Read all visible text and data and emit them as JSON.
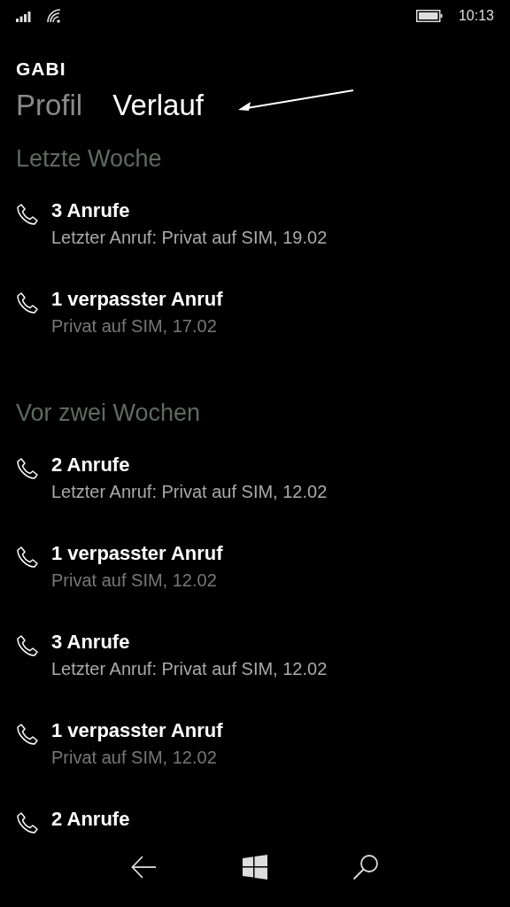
{
  "status_bar": {
    "time": "10:13"
  },
  "contact": {
    "name": "GABI"
  },
  "tabs": [
    {
      "label": "Profil",
      "selected": false
    },
    {
      "label": "Verlauf",
      "selected": true
    }
  ],
  "sections": [
    {
      "title": "Letzte Woche",
      "items": [
        {
          "kind": "calls",
          "title": "3 Anrufe",
          "detail": "Letzter Anruf: Privat auf SIM, 19.02"
        },
        {
          "kind": "missed",
          "title": "1 verpasster Anruf",
          "detail": "Privat auf SIM, 17.02"
        }
      ]
    },
    {
      "title": "Vor zwei Wochen",
      "items": [
        {
          "kind": "calls",
          "title": "2 Anrufe",
          "detail": "Letzter Anruf: Privat auf SIM, 12.02"
        },
        {
          "kind": "missed",
          "title": "1 verpasster Anruf",
          "detail": "Privat auf SIM, 12.02"
        },
        {
          "kind": "calls",
          "title": "3 Anrufe",
          "detail": "Letzter Anruf: Privat auf SIM, 12.02"
        },
        {
          "kind": "missed",
          "title": "1 verpasster Anruf",
          "detail": "Privat auf SIM, 12.02"
        },
        {
          "title": "2 Anrufe"
        }
      ]
    }
  ]
}
